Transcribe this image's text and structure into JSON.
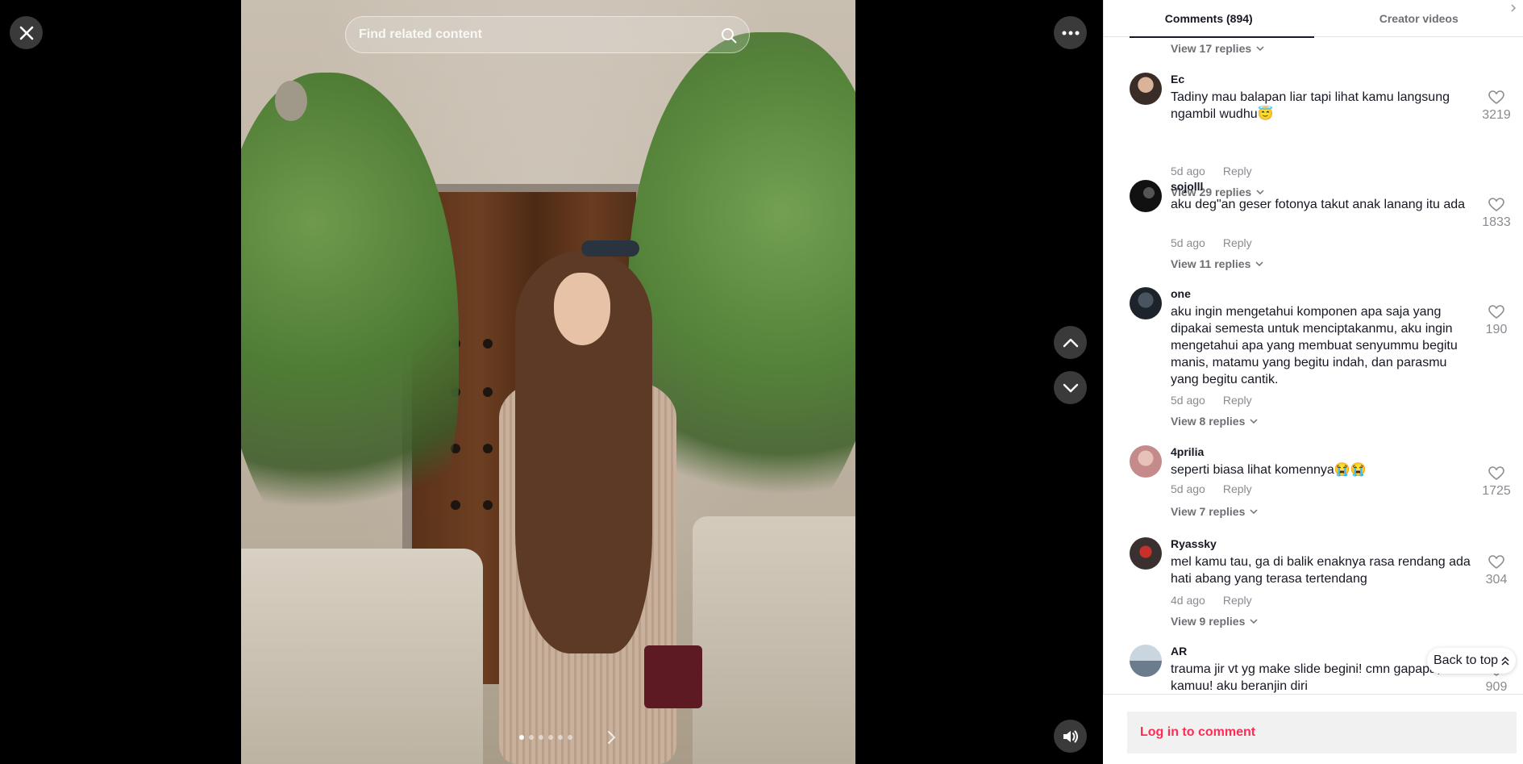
{
  "search": {
    "placeholder": "Find related content"
  },
  "slides": {
    "count": 6,
    "active_index": 0
  },
  "tabs": [
    {
      "label": "Comments (894)"
    },
    {
      "label": "Creator videos"
    }
  ],
  "top_view_replies": "View 17 replies",
  "comments": [
    {
      "username": "Ec",
      "text": "Tadiny mau balapan liar tapi lihat kamu langsung ngambil wudhu😇",
      "time": "5d ago",
      "reply": "Reply",
      "likes": "3219",
      "view_replies": "View 29 replies"
    },
    {
      "username": "sojolll",
      "text": "aku deg\"an geser fotonya takut anak lanang itu ada",
      "time": "5d ago",
      "reply": "Reply",
      "likes": "1833",
      "view_replies": "View 11 replies"
    },
    {
      "username": "one",
      "text": "aku ingin mengetahui komponen apa saja yang dipakai semesta untuk menciptakanmu, aku ingin mengetahui apa yang membuat senyummu begitu manis, matamu yang begitu indah, dan parasmu yang begitu cantik.",
      "time": "5d ago",
      "reply": "Reply",
      "likes": "190",
      "view_replies": "View 8 replies"
    },
    {
      "username": "4prilia",
      "text": "seperti biasa lihat komennya😭😭",
      "time": "5d ago",
      "reply": "Reply",
      "likes": "1725",
      "view_replies": "View 7 replies"
    },
    {
      "username": "Ryassky",
      "text": "mel kamu tau, ga di balik enaknya rasa rendang ada hati abang yang terasa tertendang",
      "time": "4d ago",
      "reply": "Reply",
      "likes": "304",
      "view_replies": "View 9 replies"
    },
    {
      "username": "AR",
      "text": "trauma jir vt yg make slide begini! cmn gapapa, demi kamuu! aku beranjin diri",
      "time": "",
      "reply": "",
      "likes": "909",
      "view_replies": ""
    }
  ],
  "back_to_top": "Back to top",
  "login": "Log in to comment",
  "colors": {
    "accent": "#fe2c55",
    "text": "#161823",
    "muted": "#8a8b91"
  }
}
